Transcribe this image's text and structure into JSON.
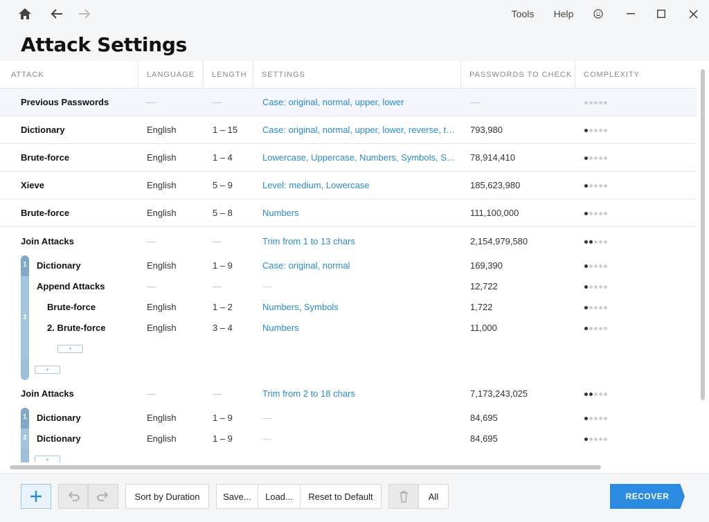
{
  "nav": {
    "home_icon": "home-icon",
    "back_icon": "arrow-left-icon",
    "forward_icon": "arrow-right-icon"
  },
  "menu": {
    "tools": "Tools",
    "help": "Help"
  },
  "page": {
    "title": "Attack Settings"
  },
  "columns": [
    "ATTACK",
    "LANGUAGE",
    "LENGTH",
    "SETTINGS",
    "PASSWORDS TO CHECK",
    "COMPLEXITY"
  ],
  "rows": [
    {
      "attack": "Previous Passwords",
      "language": "—",
      "length": "—",
      "settings": "Case: original, normal, upper, lower",
      "passwords": "—",
      "complexity": 0
    },
    {
      "attack": "Dictionary",
      "language": "English",
      "length": "1 – 15",
      "settings": "Case: original, normal, upper, lower, reverse, to...",
      "passwords": "793,980",
      "complexity": 1
    },
    {
      "attack": "Brute-force",
      "language": "English",
      "length": "1 – 4",
      "settings": "Lowercase, Uppercase, Numbers, Symbols, Spa...",
      "passwords": "78,914,410",
      "complexity": 1
    },
    {
      "attack": "Xieve",
      "language": "English",
      "length": "5 – 9",
      "settings": "Level: medium, Lowercase",
      "passwords": "185,623,980",
      "complexity": 1
    },
    {
      "attack": "Brute-force",
      "language": "English",
      "length": "5 – 8",
      "settings": "Numbers",
      "passwords": "111,100,000",
      "complexity": 1
    },
    {
      "attack": "Join Attacks",
      "language": "—",
      "length": "—",
      "settings": "Trim from 1 to 13 chars",
      "passwords": "2,154,979,580",
      "complexity": 2
    },
    {
      "attack": "Dictionary",
      "language": "English",
      "length": "1 – 9",
      "settings": "Case: original, normal",
      "passwords": "169,390",
      "complexity": 1
    },
    {
      "attack": "Append Attacks",
      "language": "—",
      "length": "—",
      "settings": "—",
      "passwords": "12,722",
      "complexity": 1
    },
    {
      "attack": "Brute-force",
      "language": "English",
      "length": "1 – 2",
      "settings": "Numbers, Symbols",
      "passwords": "1,722",
      "complexity": 1
    },
    {
      "attack": "2. Brute-force",
      "language": "English",
      "length": "3 – 4",
      "settings": "Numbers",
      "passwords": "11,000",
      "complexity": 1
    },
    {
      "attack": "Join Attacks",
      "language": "—",
      "length": "—",
      "settings": "Trim from 2 to 18 chars",
      "passwords": "7,173,243,025",
      "complexity": 2
    },
    {
      "attack": "Dictionary",
      "language": "English",
      "length": "1 – 9",
      "settings": "—",
      "passwords": "84,695",
      "complexity": 1
    },
    {
      "attack": "Dictionary",
      "language": "English",
      "length": "1 – 9",
      "settings": "—",
      "passwords": "84,695",
      "complexity": 1
    }
  ],
  "groups": {
    "num1": "1",
    "num2": "2",
    "plus": "+"
  },
  "footer": {
    "sort": "Sort by Duration",
    "save": "Save...",
    "load": "Load...",
    "reset": "Reset to Default",
    "all": "All",
    "recover": "RECOVER"
  },
  "colors": {
    "accent": "#2a8ad0",
    "recover": "#2b8be0",
    "group_bar": "#9dbfd8"
  }
}
